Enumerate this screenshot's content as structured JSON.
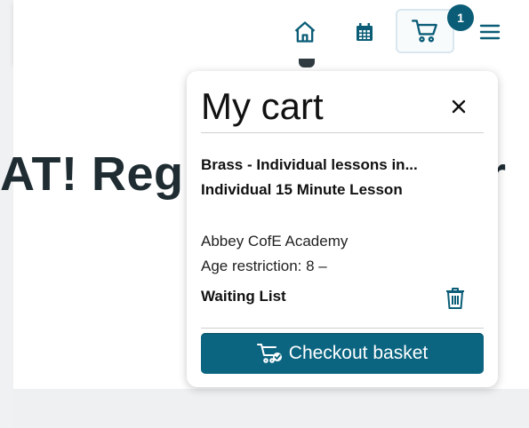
{
  "header": {
    "nav": [
      {
        "icon": "home-icon"
      },
      {
        "icon": "calendar-icon"
      },
      {
        "icon": "cart-icon",
        "badge": "1"
      },
      {
        "icon": "menu-icon"
      }
    ]
  },
  "page": {
    "title_fragment": "AT! Regi",
    "title_end_fragment": "r"
  },
  "cart": {
    "title": "My cart",
    "item": {
      "name_line1": "Brass - Individual lessons in...",
      "name_line2": "Individual 15 Minute Lesson",
      "school": "Abbey CofE Academy",
      "age": "Age restriction: 8 –",
      "status": "Waiting List"
    },
    "checkout_label": "Checkout basket"
  },
  "colors": {
    "accent": "#0b6580",
    "badge": "#0b5d77"
  }
}
